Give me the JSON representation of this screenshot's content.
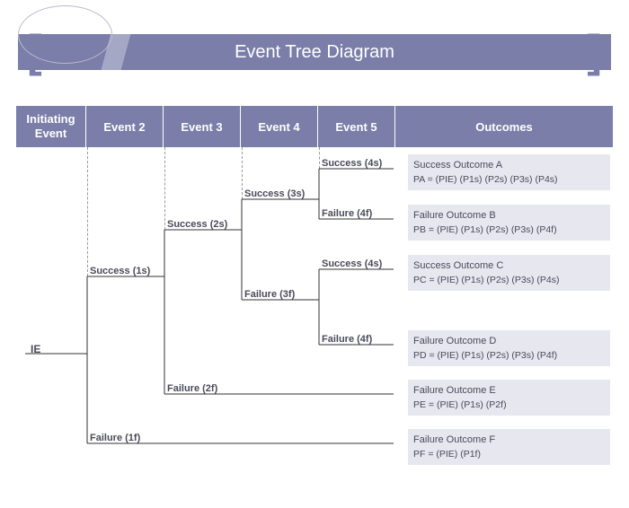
{
  "title": "Event Tree Diagram",
  "headers": {
    "ie": "Initiating Event",
    "e2": "Event 2",
    "e3": "Event 3",
    "e4": "Event 4",
    "e5": "Event 5",
    "out": "Outcomes"
  },
  "ie_label": "IE",
  "branches": {
    "s1": "Success (1s)",
    "f1": "Failure (1f)",
    "s2": "Success (2s)",
    "f2": "Failure (2f)",
    "s3": "Success (3s)",
    "f3": "Failure (3f)",
    "s4a": "Success (4s)",
    "f4a": "Failure (4f)",
    "s4b": "Success (4s)",
    "f4b": "Failure (4f)"
  },
  "outcomes": {
    "a_name": "Success Outcome A",
    "a_prob": "PA = (PIE) (P1s) (P2s) (P3s) (P4s)",
    "b_name": "Failure Outcome B",
    "b_prob": "PB = (PIE) (P1s) (P2s) (P3s) (P4f)",
    "c_name": "Success Outcome C",
    "c_prob": "PC = (PIE) (P1s) (P2s) (P3s) (P4s)",
    "d_name": "Failure Outcome D",
    "d_prob": "PD = (PIE) (P1s) (P2s) (P3s) (P4f)",
    "e_name": "Failure Outcome E",
    "e_prob": "PE = (PIE) (P1s) (P2f)",
    "f_name": "Failure Outcome F",
    "f_prob": "PF = (PIE) (P1f)"
  }
}
